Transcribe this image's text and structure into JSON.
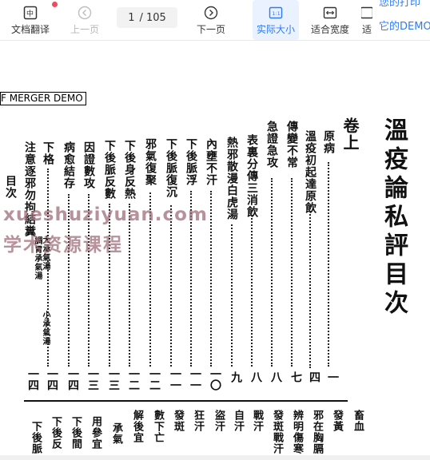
{
  "toolbar": {
    "translate_label": "文档翻译",
    "prev_label": "上一页",
    "page_current": "1",
    "page_sep_total": "/ 105",
    "next_label": "下一页",
    "actual_size_label": "实际大小",
    "fit_width_label": "适合宽度",
    "cut_label": "适",
    "demo_line1": "您的打印",
    "demo_line2": "它的DEMO"
  },
  "document": {
    "stamp": "F MERGER DEMO",
    "title": "溫疫論私評目次",
    "volume": "卷上",
    "columns": [
      {
        "text": "原病",
        "num": "一"
      },
      {
        "text": "溫疫初起達原飲",
        "num": "四"
      },
      {
        "text": "傳變不常",
        "num": "七"
      },
      {
        "text": "急證急攻",
        "num": "八"
      },
      {
        "text": "表裏分傳三消飲",
        "num": "八"
      },
      {
        "text": "熱邪散漫白虎湯",
        "num": "九"
      },
      {
        "text": "內壅不汗",
        "num": "一〇"
      },
      {
        "text": "下後脈浮",
        "num": "一一"
      },
      {
        "text": "下後脈復沉",
        "num": "一一"
      },
      {
        "text": "邪氣復聚",
        "num": "一二"
      },
      {
        "text": "下後身反熱",
        "num": "一二"
      },
      {
        "text": "下後脈反數",
        "num": "一三"
      },
      {
        "text": "因證數攻",
        "num": "一三"
      },
      {
        "text": "病愈結存",
        "num": "一四"
      },
      {
        "text": "下格",
        "num": "一四"
      },
      {
        "text": "注意逐邪勿拘結糞",
        "num": "一四"
      },
      {
        "text": "目次",
        "num": ""
      }
    ],
    "small_notes": [
      "大承氣湯",
      "小承氣湯",
      "調胃承氣湯"
    ],
    "lower_columns": [
      "畜血",
      "發黃",
      "邪在胸膈",
      "辨明傷寒",
      "發斑戰汗",
      "戰汗",
      "自汗",
      "盜汗",
      "狂汗",
      "發斑",
      "數下亡",
      "解後宜",
      "承氣",
      "用參宜",
      "下後間",
      "下後反",
      "下後脈"
    ]
  },
  "watermark": {
    "line1": "xueshuziyuan.com",
    "line2": "学术资源课程"
  }
}
